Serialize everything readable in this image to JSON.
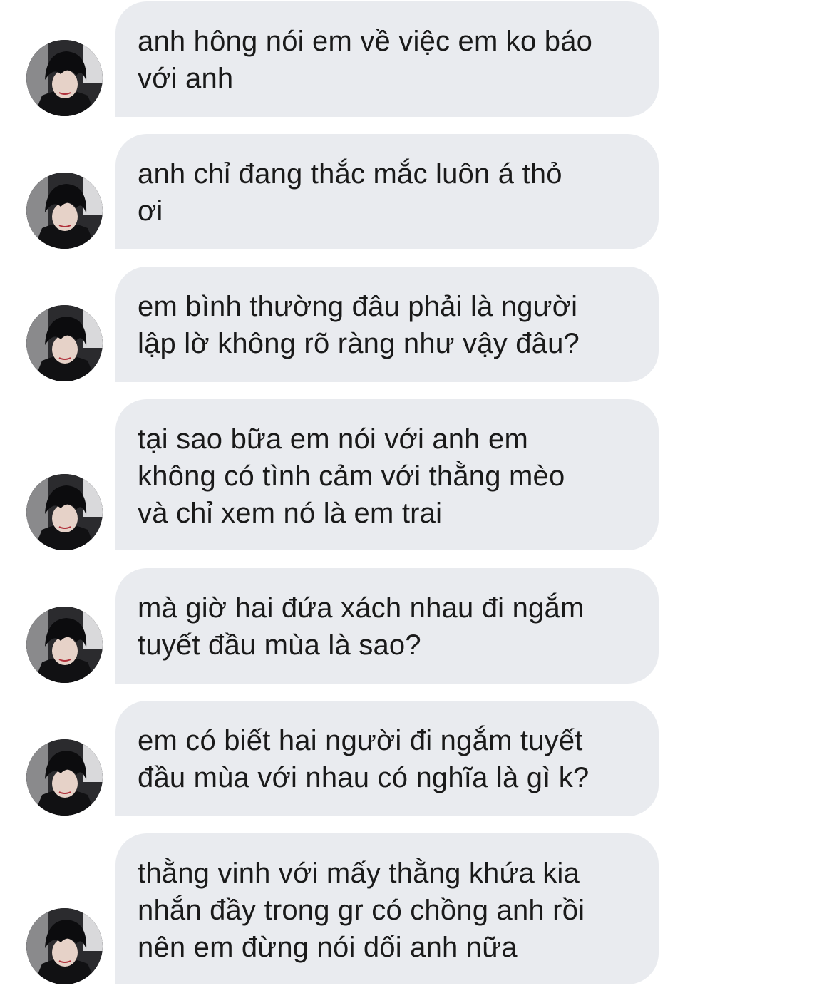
{
  "thread": {
    "messages": [
      {
        "lines": [
          "anh hông nói em về việc em ko báo",
          "với anh"
        ],
        "avatar_icon": "profile-photo-icon"
      },
      {
        "lines": [
          "anh chỉ đang thắc mắc luôn á thỏ",
          "ơi"
        ],
        "avatar_icon": "profile-photo-icon"
      },
      {
        "lines": [
          "em bình thường đâu phải là người",
          "lập lờ không rõ ràng như vậy đâu?"
        ],
        "avatar_icon": "profile-photo-icon"
      },
      {
        "lines": [
          "tại sao bữa em nói với anh em",
          "không có tình cảm với thằng mèo",
          "và chỉ xem nó là em trai"
        ],
        "avatar_icon": "profile-photo-icon"
      },
      {
        "lines": [
          "mà giờ hai đứa xách nhau đi ngắm",
          "tuyết đầu mùa là sao?"
        ],
        "avatar_icon": "profile-photo-icon"
      },
      {
        "lines": [
          "em có biết hai người đi ngắm tuyết",
          "đầu mùa với nhau có nghĩa là gì k?"
        ],
        "avatar_icon": "profile-photo-icon"
      },
      {
        "lines": [
          "thằng vinh với mấy thằng khứa kia",
          "nhắn đầy trong gr có chồng anh rồi",
          "nên em đừng nói dối anh nữa"
        ],
        "avatar_icon": "profile-photo-icon"
      }
    ]
  },
  "colors": {
    "bubble_background": "#e9ebef",
    "text": "#1a1a1a",
    "page_background": "#ffffff"
  }
}
